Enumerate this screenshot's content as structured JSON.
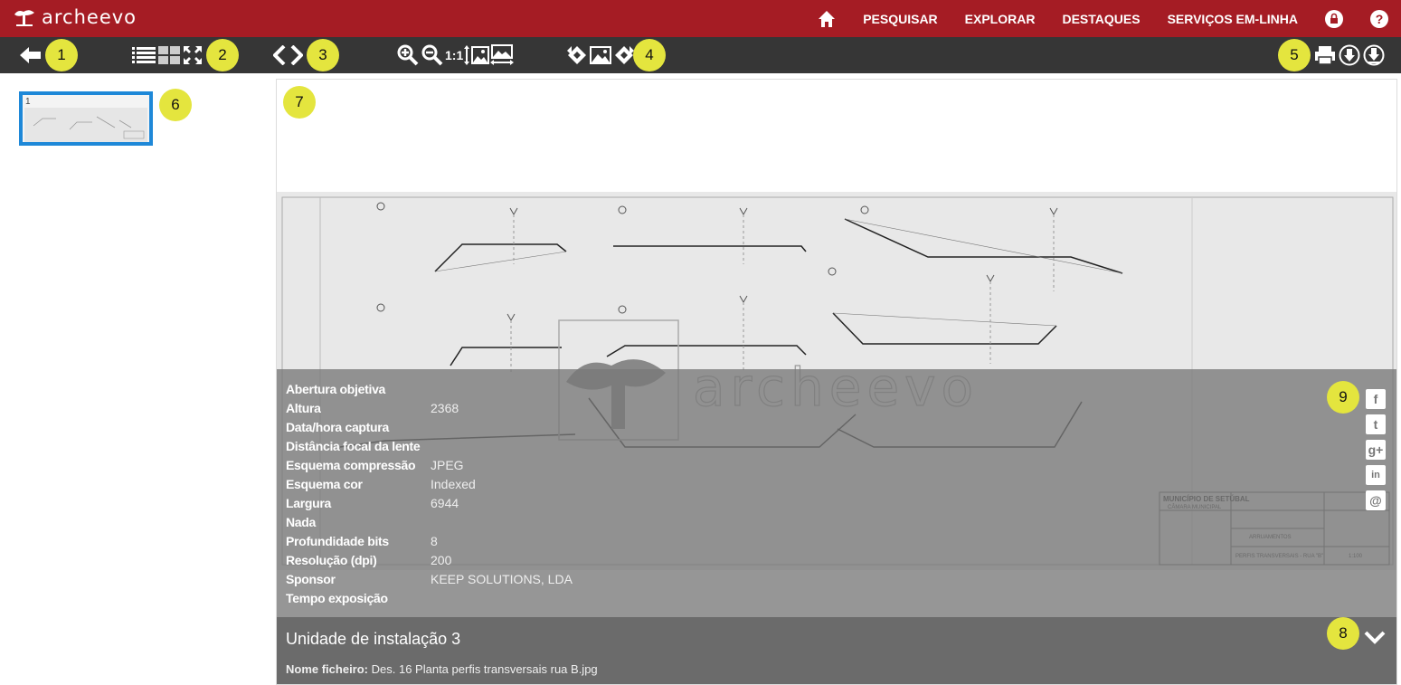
{
  "app": {
    "logo_text": "archeevo"
  },
  "nav": {
    "items": [
      "PESQUISAR",
      "EXPLORAR",
      "DESTAQUES",
      "SERVIÇOS EM-LINHA"
    ]
  },
  "toolbar": {
    "zoom_1to1_label": "1:1"
  },
  "callouts": [
    "1",
    "2",
    "3",
    "4",
    "5",
    "6",
    "7",
    "8",
    "9"
  ],
  "thumbnail": {
    "page_number": "1"
  },
  "metadata": [
    {
      "label": "Abertura objetiva",
      "value": ""
    },
    {
      "label": "Altura",
      "value": "2368"
    },
    {
      "label": "Data/hora captura",
      "value": ""
    },
    {
      "label": "Distância focal da lente",
      "value": ""
    },
    {
      "label": "Esquema compressão",
      "value": "JPEG"
    },
    {
      "label": "Esquema cor",
      "value": "Indexed"
    },
    {
      "label": "Largura",
      "value": "6944"
    },
    {
      "label": "Nada",
      "value": ""
    },
    {
      "label": "Profundidade bits",
      "value": "8"
    },
    {
      "label": "Resolução (dpi)",
      "value": "200"
    },
    {
      "label": "Sponsor",
      "value": "KEEP SOLUTIONS, LDA"
    },
    {
      "label": "Tempo exposição",
      "value": ""
    }
  ],
  "share": {
    "facebook": "f",
    "twitter": "t",
    "googleplus": "g+",
    "linkedin": "in",
    "email": "@"
  },
  "bottom": {
    "title": "Unidade de instalação 3",
    "filename_label": "Nome ficheiro:",
    "filename_value": "Des. 16 Planta perfis transversais rua B.jpg"
  },
  "drawing": {
    "watermark": "archeevo",
    "title_block": [
      "MUNICÍPIO DE SETÚBAL",
      "CÂMARA MUNICIPAL",
      "ARRUAMENTOS",
      "PERFIS TRANSVERSAIS - RUA \"B\"",
      "1:100"
    ]
  },
  "colors": {
    "brand": "#a51c24",
    "toolbar": "#363636",
    "callout": "#e4e53e",
    "thumb_border": "#1e88d8"
  }
}
